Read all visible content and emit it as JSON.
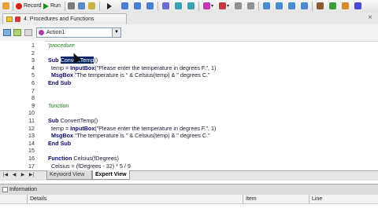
{
  "toolbar": {
    "record_label": "Record",
    "run_label": "Run"
  },
  "document_tab": {
    "title": "4. Procedures and Functions"
  },
  "action_selector": {
    "value": "Action1"
  },
  "editor": {
    "lines": [
      {
        "num": "1",
        "text": "'procedure",
        "style": "cmt"
      },
      {
        "num": "2",
        "text": "",
        "style": "plain"
      },
      {
        "num": "3",
        "text": "Sub ",
        "style": "kw",
        "after_hl": "ConvertTemp",
        "tail": "()"
      },
      {
        "num": "4",
        "text": "  temp = ",
        "style": "plain",
        "kwmid": "InputBox",
        "tail": "(\"Please enter the temperature in degrees F.\", 1)"
      },
      {
        "num": "5",
        "text": "  ",
        "style": "plain",
        "kwmid": "MsgBox",
        "tail": " \"The temperature is \" & Celsius(temp) & \" degrees C.\""
      },
      {
        "num": "6",
        "text": "End Sub",
        "style": "kw"
      },
      {
        "num": "7",
        "text": "",
        "style": "plain"
      },
      {
        "num": "8",
        "text": "",
        "style": "plain"
      },
      {
        "num": "9",
        "text": "'function",
        "style": "cmt"
      },
      {
        "num": "10",
        "text": "",
        "style": "plain"
      },
      {
        "num": "11",
        "text": "Sub ",
        "style": "kw",
        "tail": "ConvertTemp()"
      },
      {
        "num": "12",
        "text": "  temp = ",
        "style": "plain",
        "kwmid": "InputBox",
        "tail": "(\"Please enter the temperature in degrees F.\", 1)"
      },
      {
        "num": "13",
        "text": "  ",
        "style": "plain",
        "kwmid": "MsgBox",
        "tail": " \"The temperature is \" & Celsius(temp) & \" degrees C.\""
      },
      {
        "num": "14",
        "text": "End Sub",
        "style": "kw"
      },
      {
        "num": "15",
        "text": "",
        "style": "plain"
      },
      {
        "num": "16",
        "text": "Function ",
        "style": "kw",
        "tail": "Celsius(fDegrees)"
      },
      {
        "num": "17",
        "text": "  Celsius = (fDegrees - 32) * 5 / 9",
        "style": "plain"
      }
    ]
  },
  "bottom_tabs": {
    "keyword_view": "Keyword View",
    "expert_view": "Expert View"
  },
  "information_pane": {
    "title": "Information",
    "col_details": "Details",
    "col_item": "Item",
    "col_line": "Line"
  },
  "colors": {
    "comment": "#1b8a1b",
    "keyword": "#0a0a6e",
    "selection": "#0a246a"
  }
}
